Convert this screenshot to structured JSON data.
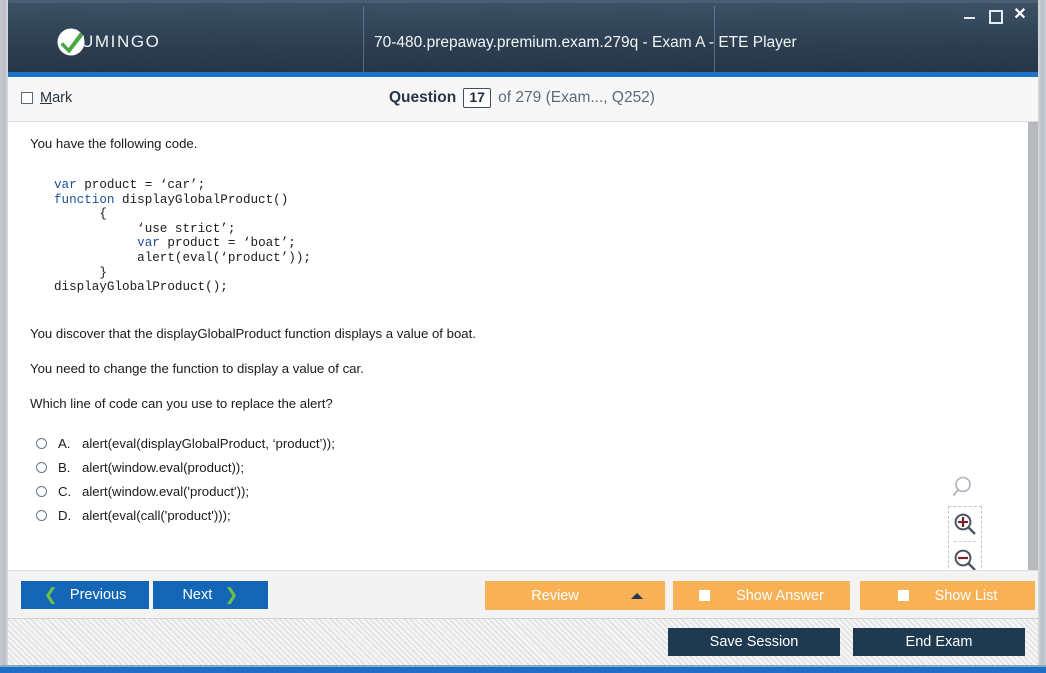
{
  "window": {
    "title": "70-480.prepaway.premium.exam.279q - Exam A - ETE Player",
    "brand_name": "UMINGO",
    "controls": {
      "minimize": "minimize",
      "maximize": "maximize",
      "close": "✕"
    }
  },
  "question_header": {
    "mark_label_prefix": "",
    "mark_label_accel": "M",
    "mark_label_rest": "ark",
    "mark_checked": false,
    "question_word": "Question",
    "question_number": "17",
    "of_text": "of 279 (Exam..., Q252)"
  },
  "content": {
    "intro": "You have the following code.",
    "code_lines": [
      {
        "segments": [
          {
            "t": "var",
            "kw": true
          },
          {
            "t": " product = ‘car’;",
            "kw": false
          }
        ]
      },
      {
        "segments": [
          {
            "t": "function",
            "kw": true
          },
          {
            "t": " displayGlobalProduct()",
            "kw": false
          }
        ]
      },
      {
        "segments": [
          {
            "t": "      {",
            "kw": false
          }
        ]
      },
      {
        "segments": [
          {
            "t": "           ‘use strict’;",
            "kw": false
          }
        ]
      },
      {
        "segments": [
          {
            "t": "           ",
            "kw": false
          },
          {
            "t": "var",
            "kw": true
          },
          {
            "t": " product = ‘boat’;",
            "kw": false
          }
        ]
      },
      {
        "segments": [
          {
            "t": "           alert(eval(‘product’));",
            "kw": false
          }
        ]
      },
      {
        "segments": [
          {
            "t": "      }",
            "kw": false
          }
        ]
      },
      {
        "segments": [
          {
            "t": "displayGlobalProduct();",
            "kw": false
          }
        ]
      }
    ],
    "paragraph_2": "You discover that the displayGlobalProduct function displays a value of boat.",
    "paragraph_3": "You need to change the function to display a value of car.",
    "paragraph_4": "Which line of code can you use to replace the alert?",
    "options": [
      {
        "letter": "A.",
        "text": "alert(eval(displayGlobalProduct, ‘product’));",
        "selected": false
      },
      {
        "letter": "B.",
        "text": "alert(window.eval(product));",
        "selected": false
      },
      {
        "letter": "C.",
        "text": "alert(window.eval('product'));",
        "selected": false
      },
      {
        "letter": "D.",
        "text": "alert(eval(call('product')));",
        "selected": false
      }
    ]
  },
  "zoom_tools": {
    "loupe": "magnifier-icon",
    "zoom_in": "zoom-in-icon",
    "zoom_out": "zoom-out-icon"
  },
  "action_bar": {
    "previous": "Previous",
    "next": "Next",
    "review": "Review",
    "show_answer": "Show Answer",
    "show_list": "Show List",
    "prev_chevron": "❮",
    "next_chevron": "❯"
  },
  "footer": {
    "save_session": "Save Session",
    "end_exam": "End Exam"
  },
  "colors": {
    "title_bar": "#2a3c4e",
    "accent_blue": "#1d72c9",
    "button_blue": "#1366b5",
    "button_orange": "#f9b156",
    "button_navy": "#1e3950",
    "chevron_green": "#6cbf4b",
    "logo_green": "#4aa543"
  }
}
